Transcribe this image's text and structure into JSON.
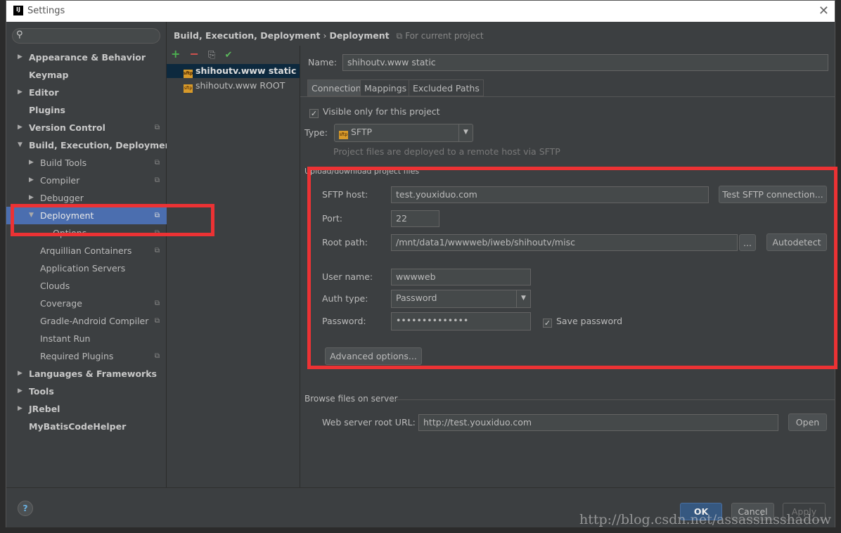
{
  "window": {
    "title": "Settings",
    "logo": "IJ"
  },
  "sidebar": {
    "items": [
      {
        "label": "Appearance & Behavior",
        "level": 0,
        "arrow": "right",
        "bold": true
      },
      {
        "label": "Keymap",
        "level": 0,
        "bold": true
      },
      {
        "label": "Editor",
        "level": 0,
        "arrow": "right",
        "bold": true
      },
      {
        "label": "Plugins",
        "level": 0,
        "bold": true
      },
      {
        "label": "Version Control",
        "level": 0,
        "arrow": "right",
        "bold": true,
        "shared": true
      },
      {
        "label": "Build, Execution, Deployment",
        "level": 0,
        "arrow": "down",
        "bold": true
      },
      {
        "label": "Build Tools",
        "level": 1,
        "arrow": "right",
        "shared": true
      },
      {
        "label": "Compiler",
        "level": 1,
        "arrow": "right",
        "shared": true
      },
      {
        "label": "Debugger",
        "level": 1,
        "arrow": "right"
      },
      {
        "label": "Deployment",
        "level": 1,
        "arrow": "down",
        "shared": true,
        "selected": true
      },
      {
        "label": "Options",
        "level": 2,
        "shared": true
      },
      {
        "label": "Arquillian Containers",
        "level": 1,
        "shared": true
      },
      {
        "label": "Application Servers",
        "level": 1
      },
      {
        "label": "Clouds",
        "level": 1
      },
      {
        "label": "Coverage",
        "level": 1,
        "shared": true
      },
      {
        "label": "Gradle-Android Compiler",
        "level": 1,
        "shared": true
      },
      {
        "label": "Instant Run",
        "level": 1
      },
      {
        "label": "Required Plugins",
        "level": 1,
        "shared": true
      },
      {
        "label": "Languages & Frameworks",
        "level": 0,
        "arrow": "right",
        "bold": true
      },
      {
        "label": "Tools",
        "level": 0,
        "arrow": "right",
        "bold": true
      },
      {
        "label": "JRebel",
        "level": 0,
        "arrow": "right",
        "bold": true
      },
      {
        "label": "MyBatisCodeHelper",
        "level": 0,
        "bold": true
      }
    ]
  },
  "breadcrumb": {
    "parent": "Build, Execution, Deployment",
    "sep": "›",
    "current": "Deployment",
    "scope": "For current project"
  },
  "servers": [
    {
      "name": "shihoutv.www static",
      "selected": true
    },
    {
      "name": "shihoutv.www ROOT"
    }
  ],
  "form": {
    "name_label": "Name:",
    "name_value": "shihoutv.www static",
    "tabs": [
      "Connection",
      "Mappings",
      "Excluded Paths"
    ],
    "visible_only": "Visible only for this project",
    "type_label": "Type:",
    "type_value": "SFTP",
    "type_hint": "Project files are deployed to a remote host via SFTP",
    "upload_section": "Upload/download project files",
    "host_label": "SFTP host:",
    "host_value": "test.youxiduo.com",
    "test_btn": "Test SFTP connection...",
    "port_label": "Port:",
    "port_value": "22",
    "root_label": "Root path:",
    "root_value": "/mnt/data1/wwwweb/iweb/shihoutv/misc",
    "browse_btn": "...",
    "autodetect_btn": "Autodetect",
    "user_label": "User name:",
    "user_value": "wwwweb",
    "auth_label": "Auth type:",
    "auth_value": "Password",
    "pass_label": "Password:",
    "pass_value": "••••••••••••••",
    "save_password": "Save password",
    "advanced_btn": "Advanced options...",
    "browse_section": "Browse files on server",
    "url_label": "Web server root URL:",
    "url_value": "http://test.youxiduo.com",
    "open_btn": "Open"
  },
  "footer": {
    "help": "?",
    "ok": "OK",
    "cancel": "Cancel",
    "apply": "Apply"
  },
  "watermark": "http://blog.csdn.net/assassinsshadow",
  "colors": {
    "highlight": "#ec3234",
    "selection": "#4b6eaf",
    "panel": "#3c3f41"
  }
}
